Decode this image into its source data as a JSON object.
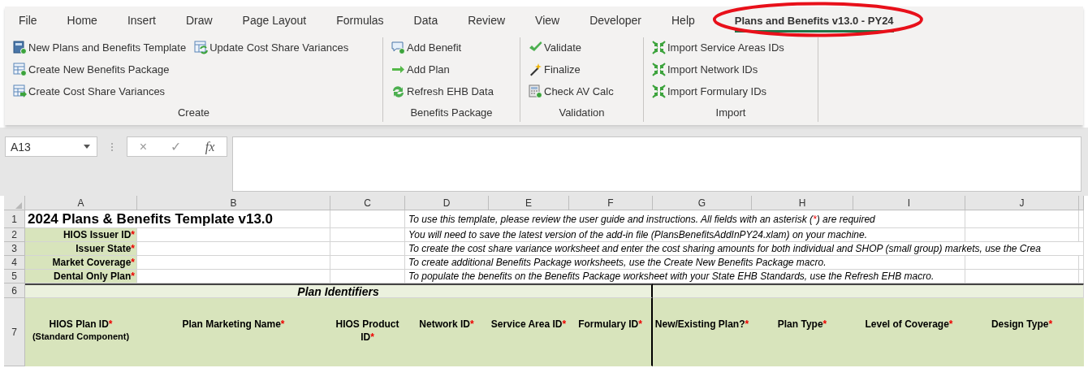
{
  "menu_tabs": [
    {
      "label": "File",
      "selected": false
    },
    {
      "label": "Home",
      "selected": false
    },
    {
      "label": "Insert",
      "selected": false
    },
    {
      "label": "Draw",
      "selected": false
    },
    {
      "label": "Page Layout",
      "selected": false
    },
    {
      "label": "Formulas",
      "selected": false
    },
    {
      "label": "Data",
      "selected": false
    },
    {
      "label": "Review",
      "selected": false
    },
    {
      "label": "View",
      "selected": false
    },
    {
      "label": "Developer",
      "selected": false
    },
    {
      "label": "Help",
      "selected": false
    },
    {
      "label": "Plans and Benefits v13.0 - PY24",
      "selected": true,
      "circled": true
    }
  ],
  "ribbon_groups": [
    {
      "label": "Create",
      "columns": [
        [
          "New Plans and Benefits Template",
          "Create New Benefits Package",
          "Create Cost Share Variances"
        ],
        [
          "Update Cost Share Variances"
        ]
      ]
    },
    {
      "label": "Benefits Package",
      "columns": [
        [
          "Add Benefit",
          "Add Plan",
          "Refresh EHB Data"
        ]
      ]
    },
    {
      "label": "Validation",
      "columns": [
        [
          "Validate",
          "Finalize",
          "Check AV Calc"
        ]
      ]
    },
    {
      "label": "Import",
      "columns": [
        [
          "Import Service Areas IDs",
          "Import Network IDs",
          "Import Formulary IDs"
        ]
      ]
    }
  ],
  "formula_bar": {
    "name_box": "A13",
    "cancel": "×",
    "enter": "✓",
    "function": "fx"
  },
  "sheet": {
    "columns": [
      "A",
      "B",
      "C",
      "D",
      "E",
      "F",
      "G",
      "H",
      "I",
      "J"
    ],
    "rows": [
      {
        "number": "1",
        "kind": "title",
        "title": "2024 Plans & Benefits Template v13.0",
        "instruction": [
          {
            "text": "To use this template, please review the user guide and instructions. All fields with an asterisk ( ",
            "kind": "text"
          },
          {
            "text": "*",
            "kind": "required"
          },
          {
            "text": ") are required",
            "kind": "text"
          }
        ]
      },
      {
        "number": "2",
        "kind": "field",
        "label": "HIOS Issuer ID",
        "mark": "*",
        "instruction": [
          {
            "text": "You will need to save the latest version of the add-in file (PlansBenefitsAddInPY24.xlam) on your machine.",
            "kind": "text"
          }
        ]
      },
      {
        "number": "3",
        "kind": "field",
        "label": "Issuer State",
        "mark": "*",
        "instruction": [
          {
            "text": "To create the cost share variance worksheet and enter the cost sharing amounts for both individual and SHOP (small group) markets, use the Crea",
            "kind": "text"
          }
        ]
      },
      {
        "number": "4",
        "kind": "field",
        "label": "Market Coverage",
        "mark": "*",
        "instruction": [
          {
            "text": "To create additional Benefits Package worksheets, use the Create New Benefits Package macro.",
            "kind": "text"
          }
        ]
      },
      {
        "number": "5",
        "kind": "field",
        "label": "Dental Only Plan",
        "mark": "*",
        "instruction": [
          {
            "text": "To populate the benefits on the Benefits Package worksheet with your State EHB Standards, use the Refresh EHB macro.",
            "kind": "text"
          }
        ]
      },
      {
        "number": "6",
        "kind": "section",
        "title": "Plan Identifiers"
      },
      {
        "number": "7",
        "kind": "headers",
        "headers": [
          {
            "text": "HIOS Plan ID",
            "mark": "*",
            "note": "(Standard Component)"
          },
          {
            "text": "Plan Marketing Name",
            "mark": "*"
          },
          {
            "text": "HIOS Product ID",
            "mark": "*"
          },
          {
            "text": "Network ID",
            "mark": "*"
          },
          {
            "text": "Service Area ID",
            "mark": "*"
          },
          {
            "text": "Formulary ID",
            "mark": "*"
          },
          {
            "text": "New/Existing Plan?",
            "mark": "*"
          },
          {
            "text": "Plan Type",
            "mark": "*"
          },
          {
            "text": "Level of Coverage",
            "mark": "*"
          },
          {
            "text": "Design Type",
            "mark": "*"
          }
        ]
      }
    ]
  }
}
